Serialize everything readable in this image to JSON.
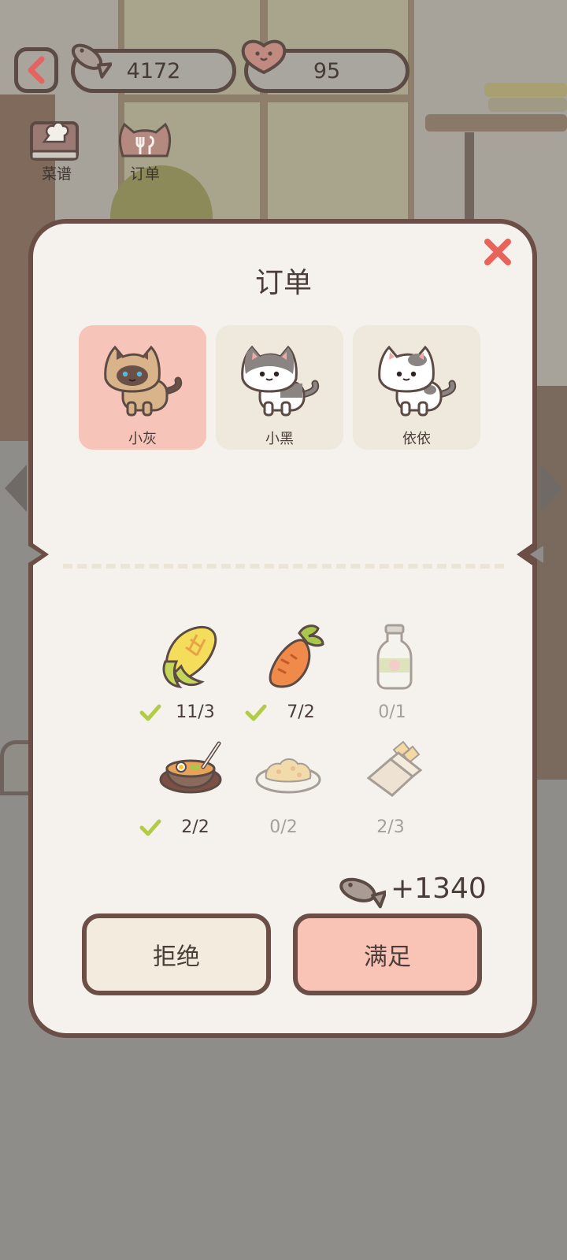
{
  "hud": {
    "fish_count": "4172",
    "heart_count": "95",
    "tabs": [
      {
        "label": "菜谱",
        "icon": "recipe-book-icon"
      },
      {
        "label": "订单",
        "icon": "order-cat-icon"
      }
    ]
  },
  "dialog": {
    "title": "订单",
    "cats": [
      {
        "name": "小灰",
        "selected": true
      },
      {
        "name": "小黑",
        "selected": false
      },
      {
        "name": "依依",
        "selected": false
      }
    ],
    "items": [
      {
        "icon": "corn-icon",
        "count": "11/3",
        "fulfilled": true
      },
      {
        "icon": "carrot-icon",
        "count": "7/2",
        "fulfilled": true
      },
      {
        "icon": "milk-bottle-icon",
        "count": "0/1",
        "fulfilled": false
      },
      {
        "icon": "stone-pot-bibimbap-icon",
        "count": "2/2",
        "fulfilled": true
      },
      {
        "icon": "fried-rice-icon",
        "count": "0/2",
        "fulfilled": false
      },
      {
        "icon": "fries-icon",
        "count": "2/3",
        "fulfilled": false
      }
    ],
    "reward": "+1340",
    "reject_label": "拒绝",
    "accept_label": "满足"
  },
  "colors": {
    "border": "#6b4f46",
    "accept": "#f9c3b5",
    "reject": "#f2ebde",
    "check": "#b2cc4a",
    "close": "#e8635a"
  }
}
